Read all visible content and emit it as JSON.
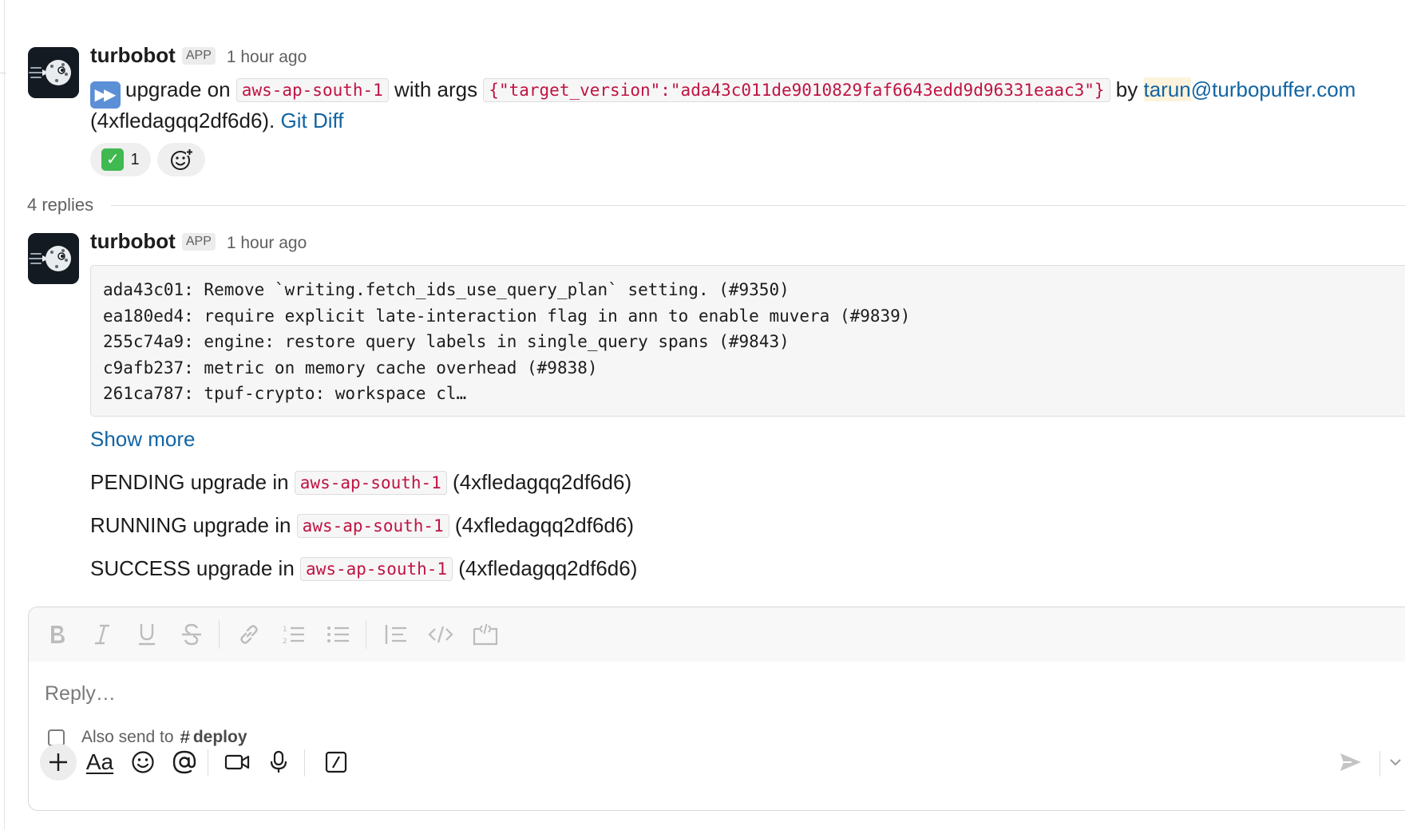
{
  "thread": {
    "parent": {
      "sender": "turbobot",
      "badge": "APP",
      "timestamp": "1 hour ago",
      "text_upgrade_on": "upgrade on",
      "region": "aws-ap-south-1",
      "text_with_args": "with args",
      "args": "{\"target_version\":\"ada43c011de9010829faf6643edd9d96331eaac3\"}",
      "text_by": "by",
      "mention_highlight": "tarun",
      "mention_rest": "@turbopuffer.com",
      "cluster_id": "(4xfledagqq2df6d6).",
      "git_diff_link": "Git Diff",
      "emoji_icon": "fast-forward-icon",
      "reactions": [
        {
          "emoji": "white-check-mark",
          "count": "1"
        }
      ]
    },
    "replies_label": "4 replies",
    "reply": {
      "sender": "turbobot",
      "badge": "APP",
      "timestamp": "1 hour ago",
      "commits": [
        "ada43c01: Remove `writing.fetch_ids_use_query_plan` setting. (#9350)",
        "ea180ed4: require explicit late-interaction flag in ann to enable muvera (#9839)",
        "255c74a9: engine: restore query labels in single_query spans (#9843)",
        "c9afb237: metric on memory cache overhead (#9838)",
        "261ca787: tpuf-crypto: workspace cl…"
      ],
      "show_more": "Show more",
      "status_lines": [
        {
          "prefix": "PENDING upgrade in",
          "region": "aws-ap-south-1",
          "suffix": "(4xfledagqq2df6d6)"
        },
        {
          "prefix": "RUNNING upgrade in",
          "region": "aws-ap-south-1",
          "suffix": "(4xfledagqq2df6d6)"
        },
        {
          "prefix": "SUCCESS upgrade in",
          "region": "aws-ap-south-1",
          "suffix": "(4xfledagqq2df6d6)"
        }
      ]
    }
  },
  "composer": {
    "placeholder": "Reply…",
    "also_send_label": "Also send to",
    "channel_hash": "#",
    "channel_name": "deploy",
    "format_tools": [
      "bold",
      "italic",
      "underline",
      "strikethrough",
      "link",
      "ordered-list",
      "bulleted-list",
      "blockquote",
      "code",
      "code-block"
    ],
    "bottom_tools": [
      "plus",
      "formatting-aa",
      "emoji",
      "mention",
      "video",
      "microphone",
      "slash-commands"
    ],
    "aa_label": "Aa"
  },
  "colors": {
    "link": "#1264a3",
    "code_text": "#c01343",
    "mention_bg": "#fdf3dc",
    "avatar_bg": "#141a21"
  }
}
